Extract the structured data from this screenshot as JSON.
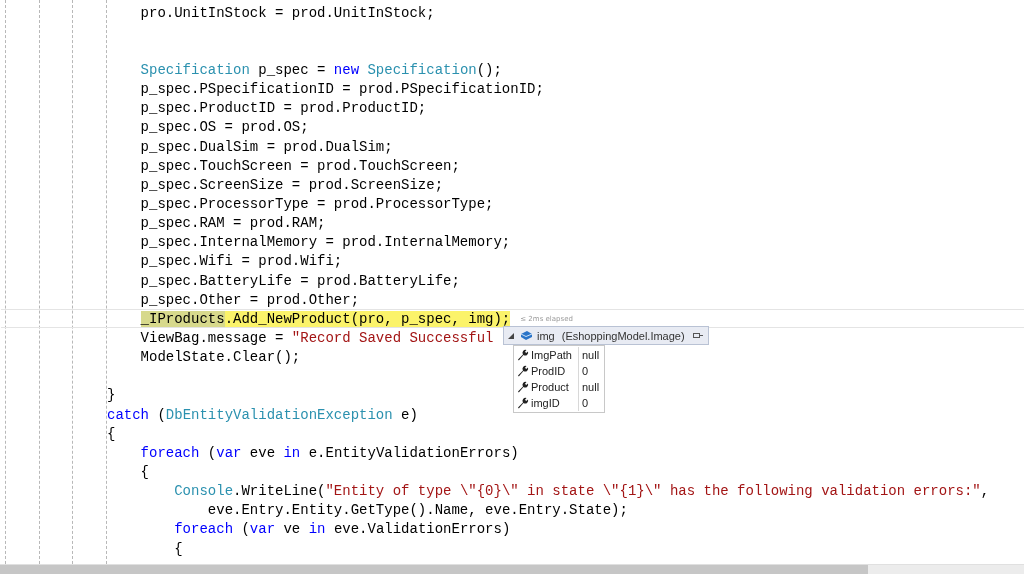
{
  "editor": {
    "lines": [
      {
        "kind": "code",
        "current": false,
        "tokens": [
          {
            "text": "    pro.UnitInStock = prod.UnitInStock;",
            "kind": "plain"
          }
        ]
      },
      {
        "kind": "blank"
      },
      {
        "kind": "blank"
      },
      {
        "kind": "code",
        "current": false,
        "tokens": [
          {
            "text": "    Specification",
            "kind": "type"
          },
          {
            "text": " p_spec = ",
            "kind": "plain"
          },
          {
            "text": "new",
            "kind": "keyword"
          },
          {
            "text": " Specification",
            "kind": "type"
          },
          {
            "text": "();",
            "kind": "plain"
          }
        ]
      },
      {
        "kind": "code",
        "current": false,
        "tokens": [
          {
            "text": "    p_spec.PSpecificationID = prod.PSpecificationID;",
            "kind": "plain"
          }
        ]
      },
      {
        "kind": "code",
        "current": false,
        "tokens": [
          {
            "text": "    p_spec.ProductID = prod.ProductID;",
            "kind": "plain"
          }
        ]
      },
      {
        "kind": "code",
        "current": false,
        "tokens": [
          {
            "text": "    p_spec.OS = prod.OS;",
            "kind": "plain"
          }
        ]
      },
      {
        "kind": "code",
        "current": false,
        "tokens": [
          {
            "text": "    p_spec.DualSim = prod.DualSim;",
            "kind": "plain"
          }
        ]
      },
      {
        "kind": "code",
        "current": false,
        "tokens": [
          {
            "text": "    p_spec.TouchScreen = prod.TouchScreen;",
            "kind": "plain"
          }
        ]
      },
      {
        "kind": "code",
        "current": false,
        "tokens": [
          {
            "text": "    p_spec.ScreenSize = prod.ScreenSize;",
            "kind": "plain"
          }
        ]
      },
      {
        "kind": "code",
        "current": false,
        "tokens": [
          {
            "text": "    p_spec.ProcessorType = prod.ProcessorType;",
            "kind": "plain"
          }
        ]
      },
      {
        "kind": "code",
        "current": false,
        "tokens": [
          {
            "text": "    p_spec.RAM = prod.RAM;",
            "kind": "plain"
          }
        ]
      },
      {
        "kind": "code",
        "current": false,
        "tokens": [
          {
            "text": "    p_spec.InternalMemory = prod.InternalMemory;",
            "kind": "plain"
          }
        ]
      },
      {
        "kind": "code",
        "current": false,
        "tokens": [
          {
            "text": "    p_spec.Wifi = prod.Wifi;",
            "kind": "plain"
          }
        ]
      },
      {
        "kind": "code",
        "current": false,
        "tokens": [
          {
            "text": "    p_spec.BatteryLife = prod.BatteryLife;",
            "kind": "plain"
          }
        ]
      },
      {
        "kind": "code",
        "current": false,
        "tokens": [
          {
            "text": "    p_spec.Other = prod.Other;",
            "kind": "plain"
          }
        ]
      },
      {
        "kind": "code",
        "current": true,
        "perf_tip": "≤ 2ms elapsed",
        "tokens": [
          {
            "text": "    _IProducts",
            "kind": "plain"
          },
          {
            "text": ".Add_NewProduct(pro, p_spec, img);",
            "kind": "plain"
          }
        ]
      },
      {
        "kind": "code",
        "current": false,
        "tokens": [
          {
            "text": "    ViewBag.message = ",
            "kind": "plain"
          },
          {
            "text": "\"Record Saved Successful",
            "kind": "string"
          }
        ]
      },
      {
        "kind": "code",
        "current": false,
        "tokens": [
          {
            "text": "    ModelState.Clear();",
            "kind": "plain"
          }
        ]
      },
      {
        "kind": "blank"
      },
      {
        "kind": "code",
        "current": false,
        "tokens": [
          {
            "text": "}",
            "kind": "plain"
          }
        ]
      },
      {
        "kind": "code",
        "current": false,
        "tokens": [
          {
            "text": "catch",
            "kind": "keyword"
          },
          {
            "text": " (",
            "kind": "plain"
          },
          {
            "text": "DbEntityValidationException",
            "kind": "type"
          },
          {
            "text": " e)",
            "kind": "plain"
          }
        ]
      },
      {
        "kind": "code",
        "current": false,
        "tokens": [
          {
            "text": "{",
            "kind": "plain"
          }
        ]
      },
      {
        "kind": "code",
        "current": false,
        "tokens": [
          {
            "text": "    foreach",
            "kind": "keyword"
          },
          {
            "text": " (",
            "kind": "plain"
          },
          {
            "text": "var",
            "kind": "keyword"
          },
          {
            "text": " eve ",
            "kind": "plain"
          },
          {
            "text": "in",
            "kind": "keyword"
          },
          {
            "text": " e.EntityValidationErrors)",
            "kind": "plain"
          }
        ]
      },
      {
        "kind": "code",
        "current": false,
        "tokens": [
          {
            "text": "    {",
            "kind": "plain"
          }
        ]
      },
      {
        "kind": "code",
        "current": false,
        "tokens": [
          {
            "text": "        Console",
            "kind": "type"
          },
          {
            "text": ".WriteLine(",
            "kind": "plain"
          },
          {
            "text": "\"Entity of type \\\"{0}\\\" in state \\\"{1}\\\" has the following validation errors:\"",
            "kind": "string"
          },
          {
            "text": ",",
            "kind": "plain"
          }
        ]
      },
      {
        "kind": "code",
        "current": false,
        "tokens": [
          {
            "text": "            eve.Entry.Entity.GetType().Name, eve.Entry.State);",
            "kind": "plain"
          }
        ]
      },
      {
        "kind": "code",
        "current": false,
        "tokens": [
          {
            "text": "        foreach",
            "kind": "keyword"
          },
          {
            "text": " (",
            "kind": "plain"
          },
          {
            "text": "var",
            "kind": "keyword"
          },
          {
            "text": " ve ",
            "kind": "plain"
          },
          {
            "text": "in",
            "kind": "keyword"
          },
          {
            "text": " eve.ValidationErrors)",
            "kind": "plain"
          }
        ]
      },
      {
        "kind": "code",
        "current": false,
        "tokens": [
          {
            "text": "        {",
            "kind": "plain"
          }
        ]
      }
    ]
  },
  "datatip": {
    "name": "img",
    "type": "(EshoppingModel.Image)",
    "expanded": true,
    "members": [
      {
        "name": "ImgPath",
        "value": "null"
      },
      {
        "name": "ProdID",
        "value": "0"
      },
      {
        "name": "Product",
        "value": "null"
      },
      {
        "name": "imgID",
        "value": "0"
      }
    ]
  }
}
